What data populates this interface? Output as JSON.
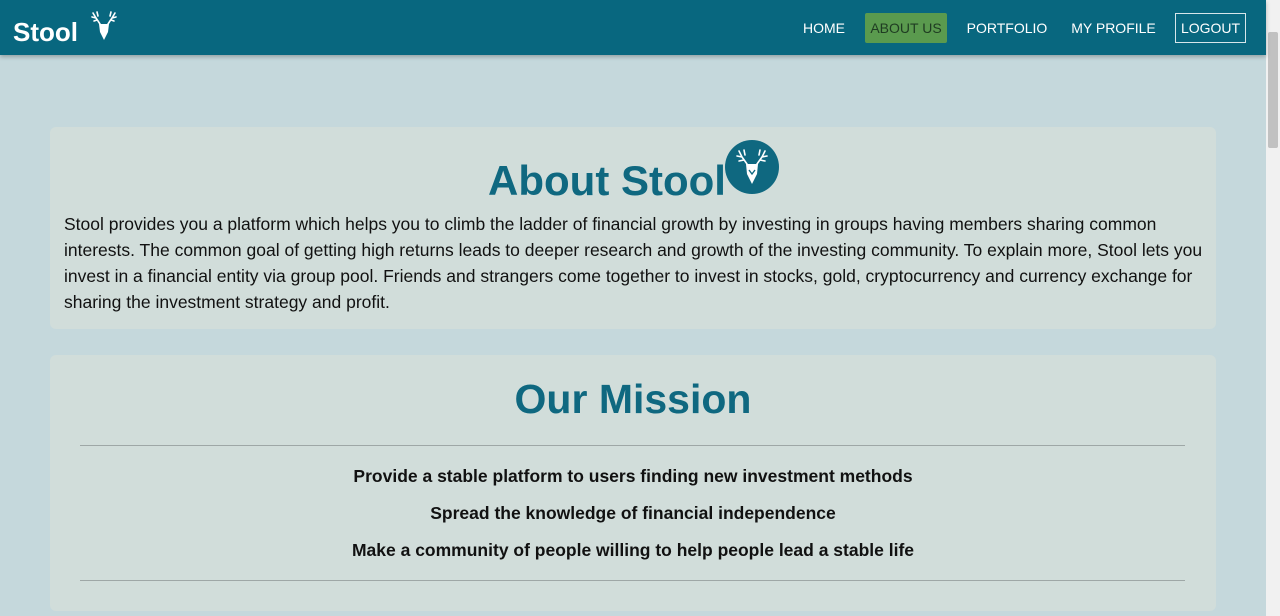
{
  "navbar": {
    "brand": "Stool",
    "brand_icon": "deer-icon",
    "links": [
      {
        "label": "HOME"
      },
      {
        "label": "ABOUT US",
        "active": true
      },
      {
        "label": "PORTFOLIO"
      },
      {
        "label": "MY PROFILE"
      },
      {
        "label": "LOGOUT"
      }
    ]
  },
  "about": {
    "heading": "About Stool",
    "logo_icon": "deer-icon",
    "text": "Stool provides you a platform which helps you to climb the ladder of financial growth by investing in groups having members sharing common interests. The common goal of getting high returns leads to deeper research and growth of the investing community. To explain more, Stool lets you invest in a financial entity via group pool. Friends and strangers come together to invest in stocks, gold, cryptocurrency and currency exchange for sharing the investment strategy and profit."
  },
  "mission": {
    "heading": "Our Mission",
    "items": [
      "Provide a stable platform to users finding new investment methods",
      "Spread the knowledge of financial independence",
      "Make a community of people willing to help people lead a stable life"
    ]
  },
  "colors": {
    "navbar": "#08677f",
    "accent": "#0f6880",
    "active_nav": "#5a9a4e",
    "background": "#c5d8dc",
    "card": "#d1ddda"
  }
}
